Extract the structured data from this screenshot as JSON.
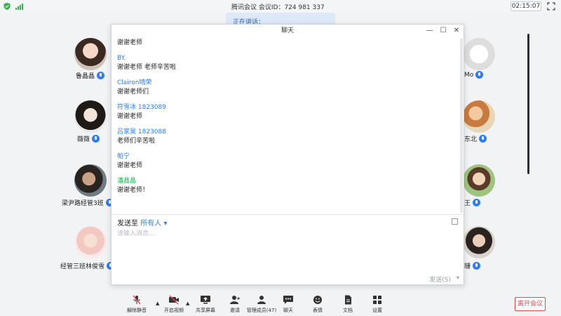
{
  "topbar": {
    "meeting_title": "腾讯会议 会议ID：724 981 337",
    "timer": "02:15:07"
  },
  "speaker_banner": "正在讲话：",
  "participants": [
    {
      "name": "鲁晶晶"
    },
    {
      "name": "薇薇"
    },
    {
      "name": "梁尹路经管3班"
    },
    {
      "name": "经管三班林俊雪"
    },
    {
      "name": "Mo"
    },
    {
      "name": "东北"
    },
    {
      "name": "王"
    },
    {
      "name": "珊"
    }
  ],
  "chat": {
    "title": "聊天",
    "window_buttons": {
      "minimize": "—",
      "maximize": "☐",
      "close": "✕"
    },
    "messages": [
      {
        "name": "",
        "text": "谢谢老师"
      },
      {
        "name": "BY.",
        "text": "谢谢老师 老师辛苦啦"
      },
      {
        "name": "Clairon晴荣",
        "text": "谢谢老师们"
      },
      {
        "name": "符雪冰 1823089",
        "text": "谢谢老师"
      },
      {
        "name": "吕家昊 1823088",
        "text": "老师们辛苦啦"
      },
      {
        "name": "帕宁",
        "text": "谢谢老师"
      },
      {
        "name": "潘晶晶",
        "text": "谢谢老师！"
      }
    ],
    "send_to_label": "发送至",
    "send_to_recipient": "所有人",
    "input_placeholder": "请输入消息...",
    "send_label": "发送(S)"
  },
  "toolbar": {
    "items": [
      {
        "label": "解除静音"
      },
      {
        "label": "开启视频"
      },
      {
        "label": "共享屏幕"
      },
      {
        "label": "邀请"
      },
      {
        "label": "管理成员(47)"
      },
      {
        "label": "聊天"
      },
      {
        "label": "表情"
      },
      {
        "label": "文档"
      },
      {
        "label": "设置"
      }
    ],
    "leave_label": "离开会议"
  },
  "colors": {
    "accent": "#2f7cf6",
    "green_name": "#22b14c",
    "leave": "#e24a4a"
  }
}
